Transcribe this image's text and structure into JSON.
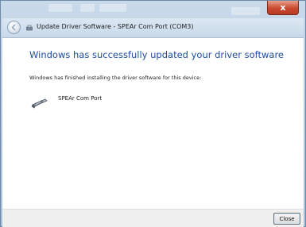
{
  "window": {
    "title": "Update Driver Software - SPEAr Com Port (COM3)",
    "close_glyph": "x"
  },
  "content": {
    "heading": "Windows has successfully updated your driver software",
    "description": "Windows has finished installing the driver software for this device:",
    "device_name": "SPEAr Com Port",
    "device_icon": "port-connector-icon"
  },
  "footer": {
    "close_label": "Close"
  },
  "colors": {
    "heading": "#1e4ea3",
    "close_button_red": "#c74a2f"
  }
}
